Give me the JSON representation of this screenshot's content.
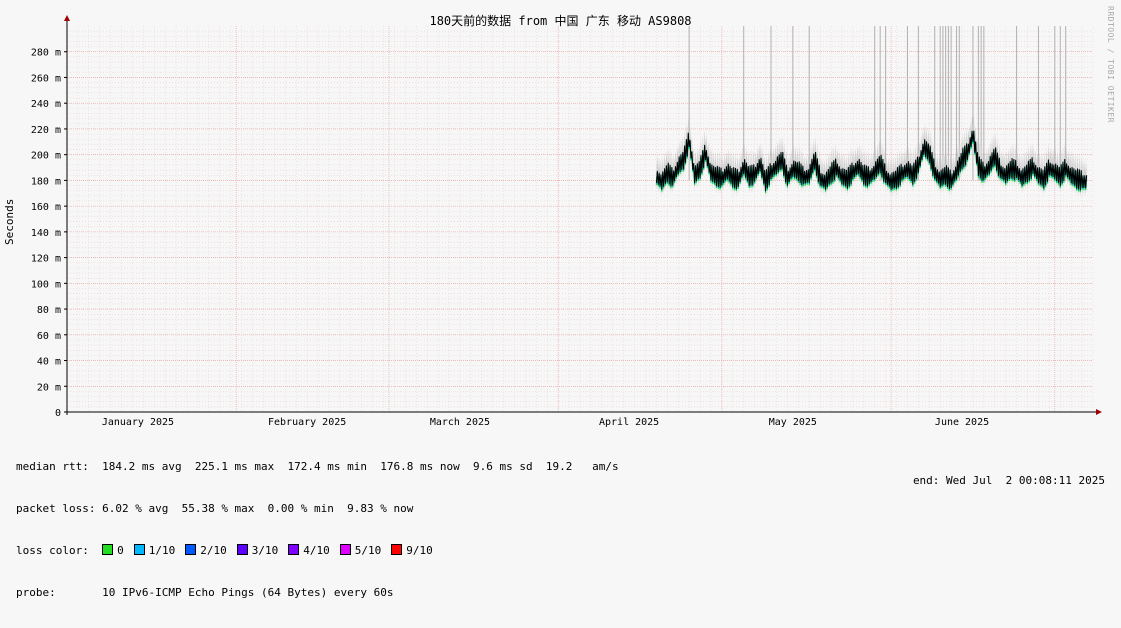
{
  "title": "180天前的数据 from 中国 广东 移动 AS9808",
  "watermark": "RRDTOOL / TOBI OETIKER",
  "colors": {
    "background": "#f7f7f7",
    "grid": "#e6a0a0",
    "axis": "#000000",
    "median_line": "#000000",
    "smoke": "#b0b0b0"
  },
  "chart_data": {
    "type": "line",
    "ylabel": "Seconds",
    "ylim": [
      0,
      0.3
    ],
    "yticks": [
      "0",
      "20 m",
      "40 m",
      "60 m",
      "80 m",
      "100 m",
      "120 m",
      "140 m",
      "160 m",
      "180 m",
      "200 m",
      "220 m",
      "240 m",
      "260 m",
      "280 m"
    ],
    "ytick_values": [
      0,
      0.02,
      0.04,
      0.06,
      0.08,
      0.1,
      0.12,
      0.14,
      0.16,
      0.18,
      0.2,
      0.22,
      0.24,
      0.26,
      0.28
    ],
    "xrange_days": [
      0,
      188
    ],
    "month_labels": [
      {
        "label": "January 2025",
        "day": 13
      },
      {
        "label": "February 2025",
        "day": 44
      },
      {
        "label": "March 2025",
        "day": 72
      },
      {
        "label": "April 2025",
        "day": 103
      },
      {
        "label": "May 2025",
        "day": 133
      },
      {
        "label": "June 2025",
        "day": 164
      }
    ],
    "month_starts": [
      0,
      31,
      59,
      90,
      120,
      151,
      181
    ],
    "grid": true,
    "series": [
      {
        "name": "median rtt",
        "x": [
          108,
          109,
          110,
          111,
          112,
          113,
          114,
          115,
          116,
          117,
          118,
          119,
          120,
          121,
          122,
          123,
          124,
          125,
          126,
          127,
          128,
          129,
          130,
          131,
          132,
          133,
          134,
          135,
          136,
          137,
          138,
          139,
          140,
          141,
          142,
          143,
          144,
          145,
          146,
          147,
          148,
          149,
          150,
          151,
          152,
          153,
          154,
          155,
          156,
          157,
          158,
          159,
          160,
          161,
          162,
          163,
          164,
          165,
          166,
          167,
          168,
          169,
          170,
          171,
          172,
          173,
          174,
          175,
          176,
          177,
          178,
          179,
          180,
          181,
          182,
          183,
          184,
          185,
          186,
          187
        ],
        "y": [
          0.182,
          0.178,
          0.185,
          0.18,
          0.19,
          0.195,
          0.21,
          0.183,
          0.188,
          0.2,
          0.185,
          0.182,
          0.18,
          0.186,
          0.181,
          0.179,
          0.19,
          0.182,
          0.183,
          0.192,
          0.178,
          0.185,
          0.19,
          0.195,
          0.18,
          0.188,
          0.186,
          0.181,
          0.183,
          0.195,
          0.18,
          0.178,
          0.184,
          0.188,
          0.182,
          0.18,
          0.185,
          0.19,
          0.183,
          0.181,
          0.186,
          0.192,
          0.182,
          0.178,
          0.18,
          0.184,
          0.188,
          0.183,
          0.19,
          0.205,
          0.2,
          0.185,
          0.18,
          0.183,
          0.178,
          0.186,
          0.195,
          0.2,
          0.215,
          0.19,
          0.184,
          0.19,
          0.198,
          0.186,
          0.183,
          0.188,
          0.186,
          0.181,
          0.185,
          0.189,
          0.183,
          0.18,
          0.188,
          0.186,
          0.182,
          0.188,
          0.183,
          0.18,
          0.178,
          0.178
        ]
      }
    ],
    "spikes_days": [
      114,
      124,
      129,
      133,
      136,
      148,
      149,
      150,
      154,
      156,
      159,
      160,
      160.5,
      161,
      161.5,
      162,
      163,
      163.5,
      166,
      167,
      167.5,
      168,
      174,
      178,
      181,
      182,
      183
    ]
  },
  "stats": {
    "median_rtt": {
      "label": "median rtt:",
      "text": "184.2 ms avg  225.1 ms max  172.4 ms min  176.8 ms now  9.6 ms sd  19.2   am/s"
    },
    "packet_loss": {
      "label": "packet loss:",
      "text": "6.02 % avg  55.38 % max  0.00 % min  9.83 % now"
    },
    "loss_color": {
      "label": "loss color:",
      "items": [
        {
          "label": "0",
          "color": "#22dd22"
        },
        {
          "label": "1/10",
          "color": "#00b8ff"
        },
        {
          "label": "2/10",
          "color": "#0059ff"
        },
        {
          "label": "3/10",
          "color": "#5e00ff"
        },
        {
          "label": "4/10",
          "color": "#7e00ff"
        },
        {
          "label": "5/10",
          "color": "#dd00ff"
        },
        {
          "label": "9/10",
          "color": "#ff0000"
        }
      ]
    },
    "probe": {
      "label": "probe:",
      "text": "10 IPv6-ICMP Echo Pings (64 Bytes) every 60s"
    },
    "end": "end: Wed Jul  2 00:08:11 2025"
  }
}
